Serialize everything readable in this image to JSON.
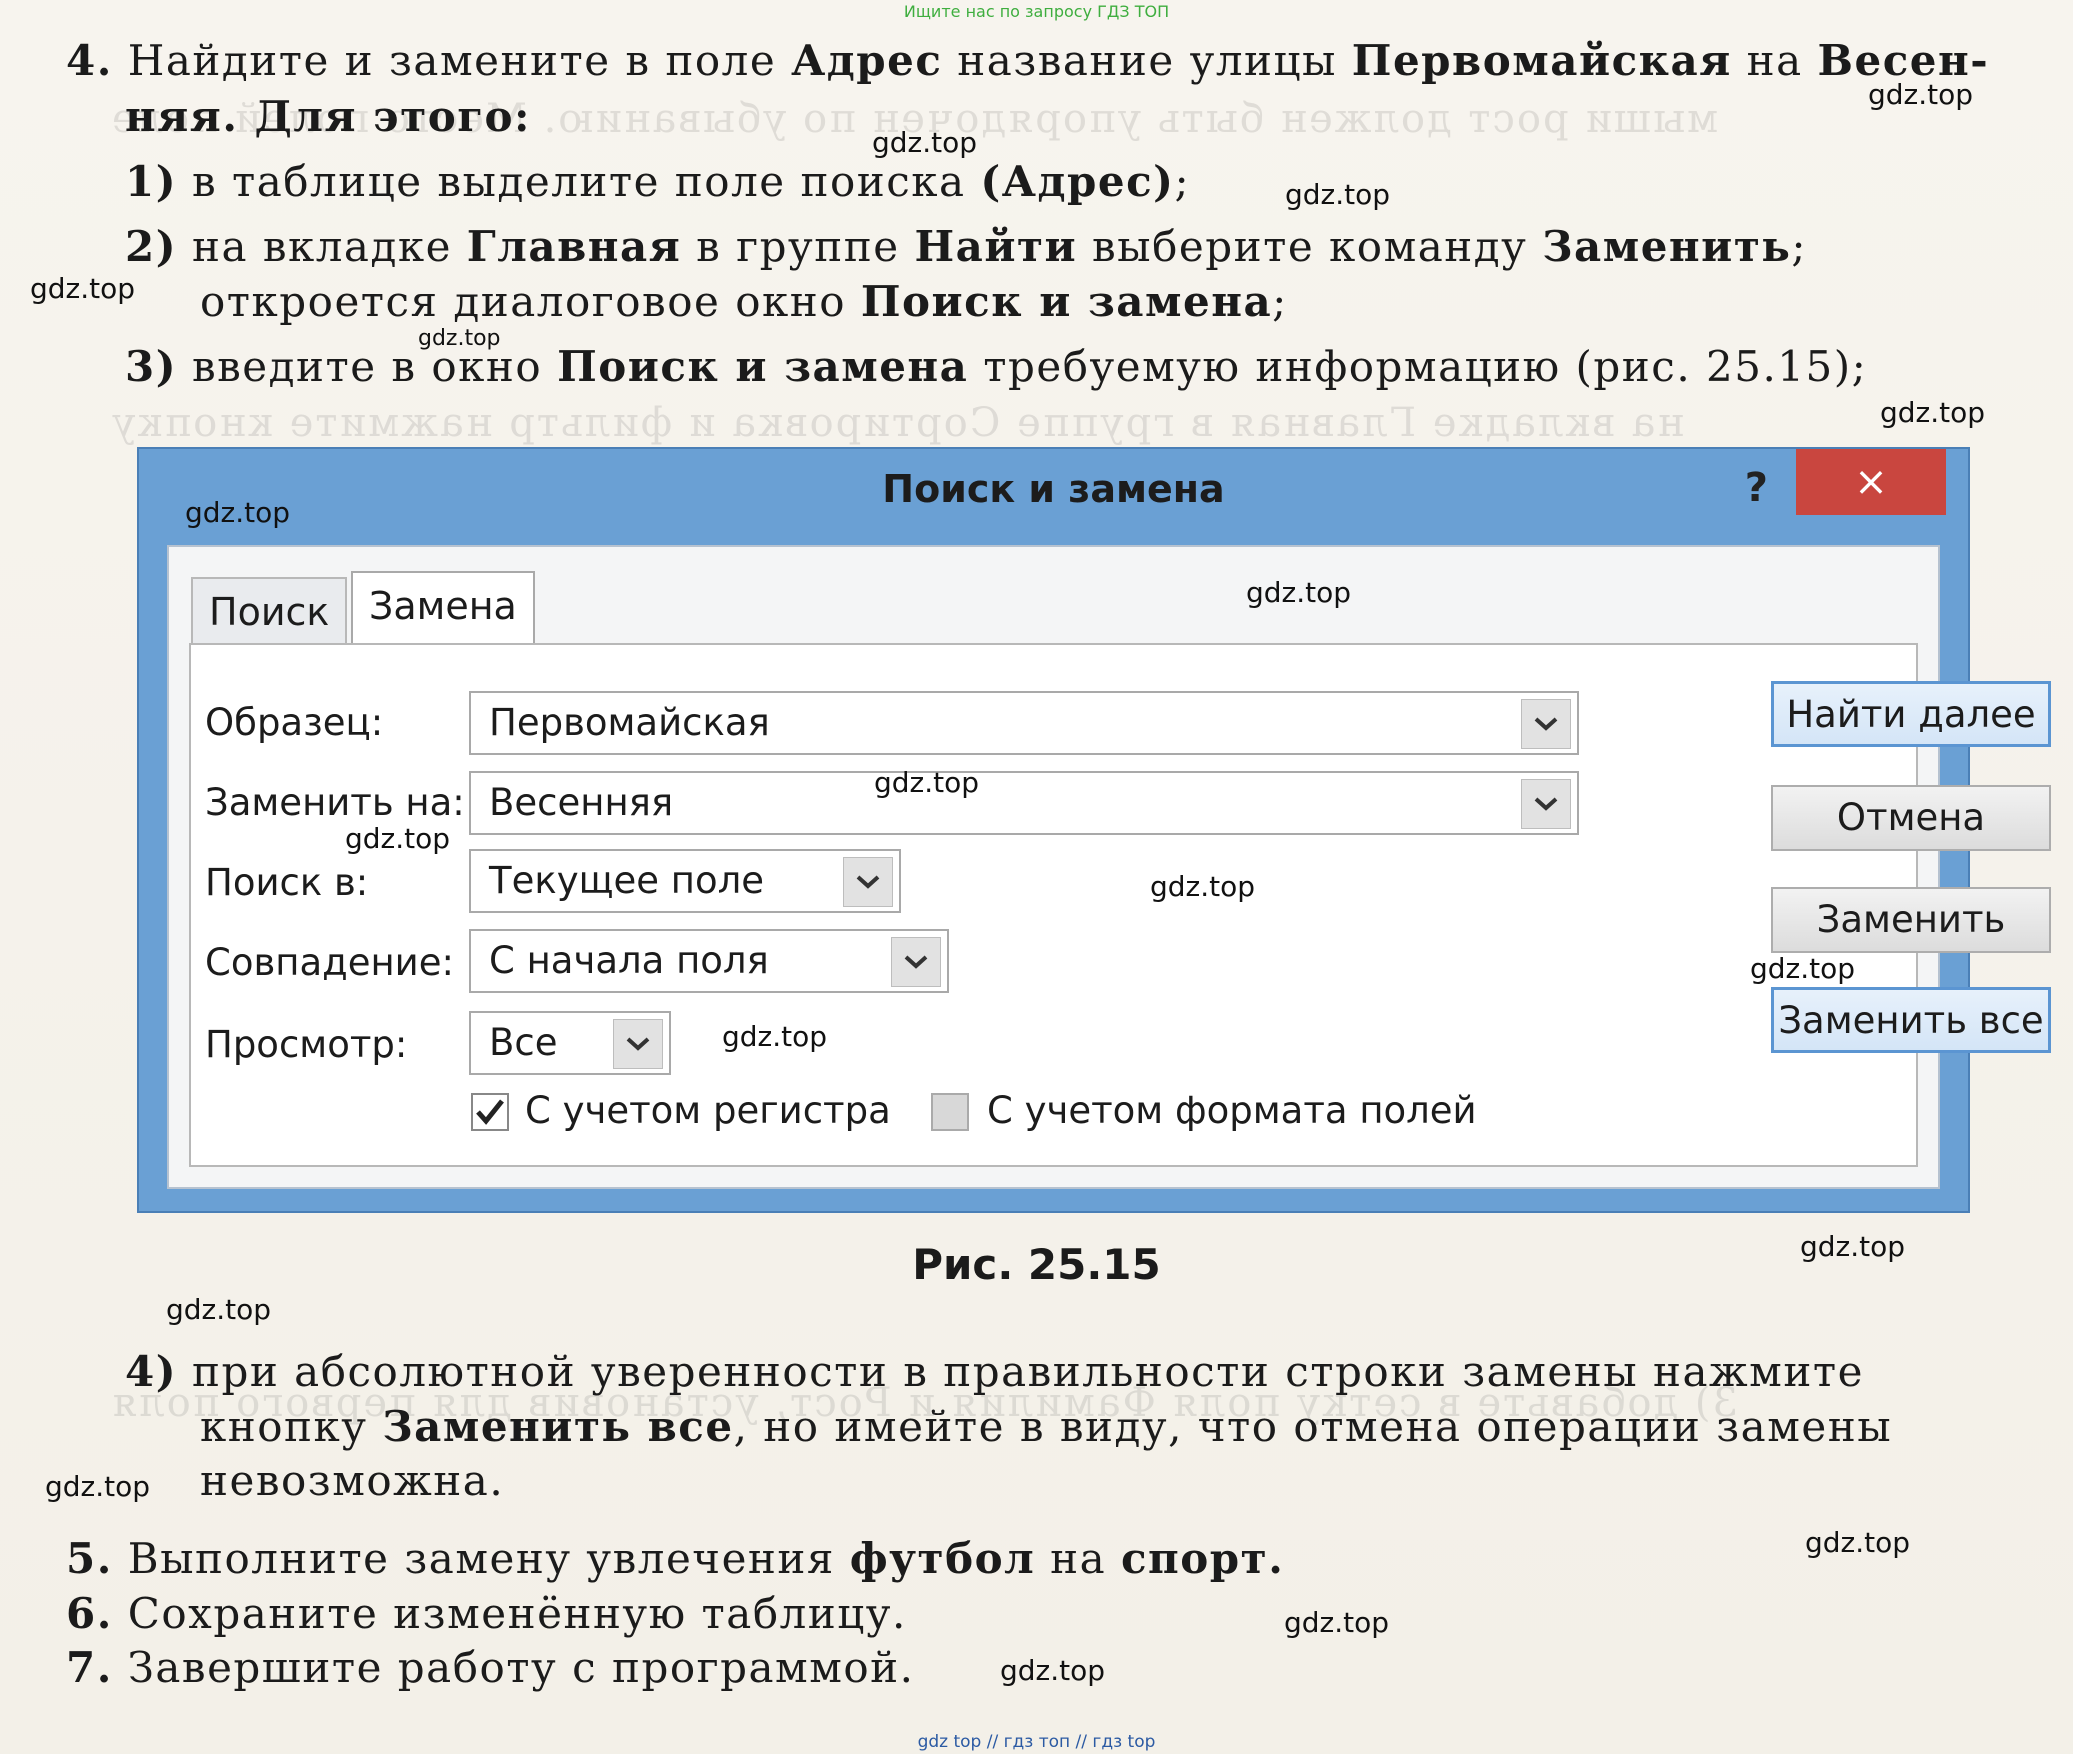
{
  "header": {
    "top_note": "Ищите нас по запросу ГДЗ ТОП"
  },
  "step4": {
    "line1": {
      "num": "4.",
      "t1": " Найдите и замените в поле ",
      "b1": "Адрес",
      "t2": " название улицы ",
      "b2": "Первомайская",
      "t3": " на ",
      "b3": "Весен-"
    },
    "line2": {
      "b1": "няя",
      "t1": ". Для этого:"
    },
    "sub1": {
      "num": "1)",
      "t1": " в таблице выделите поле поиска ",
      "b1": "(Адрес)",
      "t2": ";"
    },
    "sub2a": {
      "num": "2)",
      "t1": " на вкладке ",
      "b1": "Главная",
      "t2": " в группе ",
      "b2": "Найти",
      "t3": " выберите команду ",
      "b3": "Заменить",
      "t4": ";"
    },
    "sub2b": {
      "t1": "откроется диалоговое окно ",
      "b1": "Поиск и замена",
      "t2": ";"
    },
    "sub3": {
      "num": "3)",
      "t1": " введите в окно ",
      "b1": "Поиск и замена",
      "t2": " требуемую информацию (рис. 25.15);"
    },
    "sub4a": {
      "num": "4)",
      "t1": " при абсолютной уверенности в правильности строки замены нажмите"
    },
    "sub4b": {
      "t1": "кнопку ",
      "b1": "Заменить все",
      "t2": ", но имейте в виду, что отмена операции замены"
    },
    "sub4c": {
      "t1": "невозможна."
    }
  },
  "dialog": {
    "title": "Поиск и замена",
    "help": "?",
    "close": "×",
    "tabs": [
      "Поиск",
      "Замена"
    ],
    "labels": {
      "find": "Образец:",
      "replace": "Заменить на:",
      "look_in": "Поиск в:",
      "match": "Совпадение:",
      "search": "Просмотр:"
    },
    "values": {
      "find": "Первомайская",
      "replace": "Весенняя",
      "look_in": "Текущее поле",
      "match": "С начала поля",
      "search": "Все"
    },
    "checkboxes": {
      "match_case": {
        "label": "С учетом регистра",
        "checked": true
      },
      "search_fields_as_formatted": {
        "label": "С учетом формата полей",
        "checked": false
      }
    },
    "buttons": {
      "find_next": "Найти далее",
      "cancel": "Отмена",
      "replace": "Заменить",
      "replace_all": "Заменить все"
    }
  },
  "caption": "Рис. 25.15",
  "steps": {
    "s5": {
      "num": "5.",
      "t1": " Выполните замену увлечения ",
      "b1": "футбол",
      "t2": " на ",
      "b2": "спорт",
      "t3": "."
    },
    "s6": {
      "num": "6.",
      "t1": " Сохраните изменённую таблицу."
    },
    "s7": {
      "num": "7.",
      "t1": " Завершите работу с программой."
    }
  },
  "watermark": "gdz.top",
  "footer": "gdz top  //  гдз топ  //  гдз top",
  "colors": {
    "title_bar": "#6aa0d4",
    "close": "#c9463f",
    "note_green": "#3fae3f",
    "footer_blue": "#2b5aa3"
  }
}
